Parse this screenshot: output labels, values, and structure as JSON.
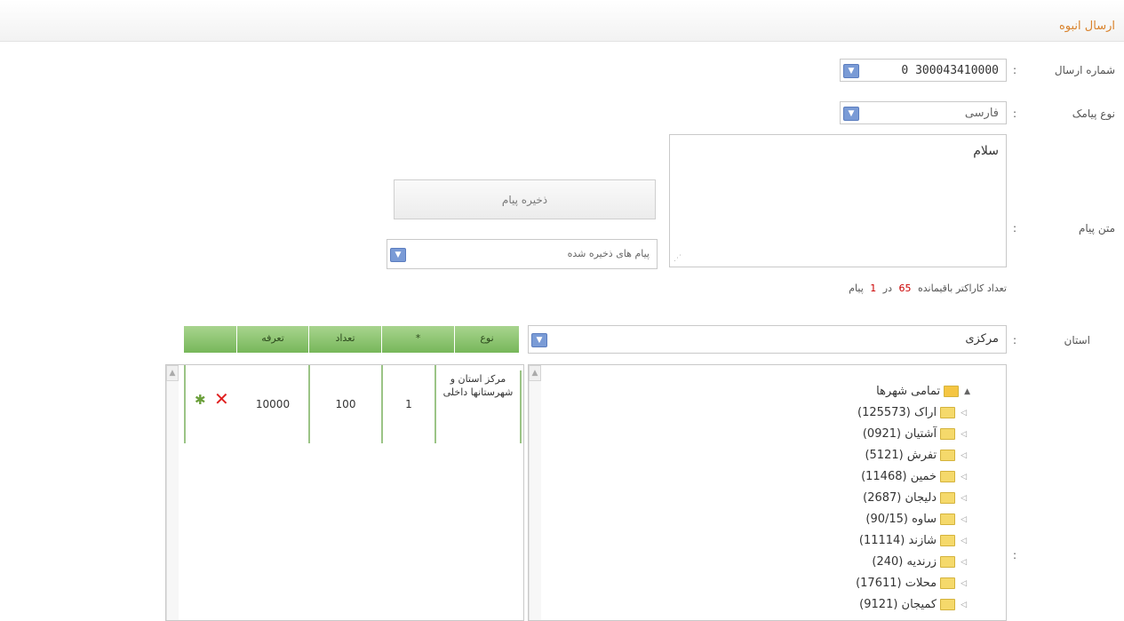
{
  "header": {
    "title": "ارسال انبوه"
  },
  "form": {
    "sender_label": "شماره ارسال",
    "sender_value": "300043410000 0",
    "type_label": "نوع پیامک",
    "type_value": "فارسی",
    "message_label": "متن پیام",
    "message_text": "سلام",
    "save_button": "ذخیره پیام",
    "saved_messages_placeholder": "پیام های ذخیره شده",
    "counter_prefix": "تعداد کاراکتر باقیمانده",
    "counter_remaining": "65",
    "counter_middle": "در",
    "counter_parts": "1",
    "counter_suffix": "پیام",
    "province_label": "استان",
    "province_value": "مرکزی",
    "colon": ":"
  },
  "table": {
    "headers": [
      "",
      "تعرفه",
      "تعداد",
      "*",
      "نوع"
    ],
    "row": {
      "type": "مرکز استان و شهرستانها داخلی",
      "star": "1",
      "count": "100",
      "tariff": "10000"
    }
  },
  "tree": {
    "root": "تمامی شهرها",
    "items": [
      "اراک (125573)",
      "آشتیان (0921)",
      "تفرش (5121)",
      "خمین (11468)",
      "دلیجان (2687)",
      "ساوه (90/15)",
      "شازند (11114)",
      "زرندیه (240)",
      "محلات (17611)",
      "کمیجان (9121)"
    ]
  },
  "colors": {
    "accent": "#d9822b",
    "green_header": "#8cc46f",
    "counter_red": "#cc0000"
  }
}
